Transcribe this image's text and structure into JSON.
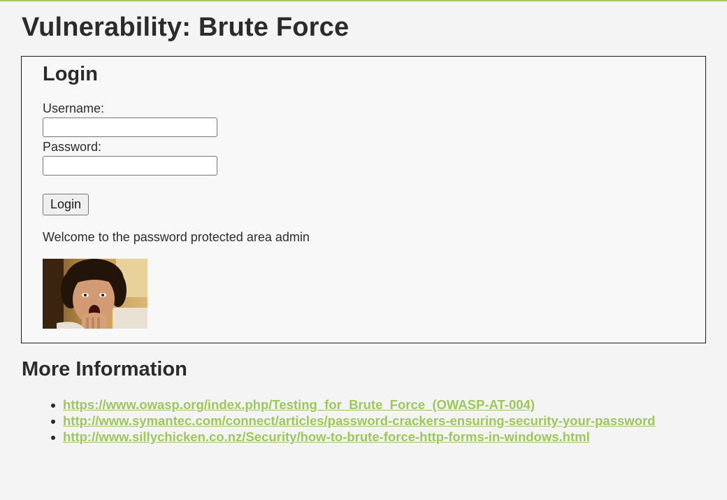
{
  "page": {
    "title": "Vulnerability: Brute Force"
  },
  "login": {
    "heading": "Login",
    "username_label": "Username:",
    "username_value": "",
    "password_label": "Password:",
    "password_value": "",
    "submit_label": "Login",
    "welcome_message": "Welcome to the password protected area admin"
  },
  "more_info": {
    "heading": "More Information",
    "links": [
      {
        "text": "https://www.owasp.org/index.php/Testing_for_Brute_Force_(OWASP-AT-004)"
      },
      {
        "text": "http://www.symantec.com/connect/articles/password-crackers-ensuring-security-your-password"
      },
      {
        "text": "http://www.sillychicken.co.nz/Security/how-to-brute-force-http-forms-in-windows.html"
      }
    ]
  },
  "colors": {
    "accent": "#a6c95f",
    "link": "#9dc75b",
    "text": "#2b2b2b",
    "background": "#f4f4f4"
  }
}
